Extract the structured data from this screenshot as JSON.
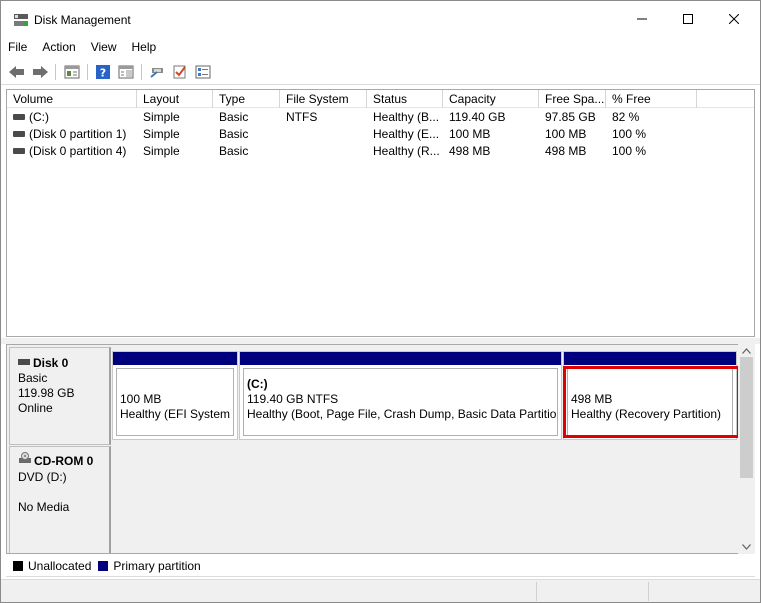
{
  "window": {
    "title": "Disk Management"
  },
  "menu": [
    "File",
    "Action",
    "View",
    "Help"
  ],
  "volume_list": {
    "columns": [
      "Volume",
      "Layout",
      "Type",
      "File System",
      "Status",
      "Capacity",
      "Free Spa...",
      "% Free"
    ],
    "rows": [
      {
        "volume": "(C:)",
        "layout": "Simple",
        "type": "Basic",
        "fs": "NTFS",
        "status": "Healthy (B...",
        "capacity": "119.40 GB",
        "free": "97.85 GB",
        "pct": "82 %"
      },
      {
        "volume": "(Disk 0 partition 1)",
        "layout": "Simple",
        "type": "Basic",
        "fs": "",
        "status": "Healthy (E...",
        "capacity": "100 MB",
        "free": "100 MB",
        "pct": "100 %"
      },
      {
        "volume": "(Disk 0 partition 4)",
        "layout": "Simple",
        "type": "Basic",
        "fs": "",
        "status": "Healthy (R...",
        "capacity": "498 MB",
        "free": "498 MB",
        "pct": "100 %"
      }
    ]
  },
  "disk0": {
    "name": "Disk 0",
    "type": "Basic",
    "size": "119.98 GB",
    "state": "Online",
    "partitions": [
      {
        "name": "",
        "size": "100 MB",
        "status": "Healthy (EFI System P"
      },
      {
        "name": "(C:)",
        "size": "119.40 GB NTFS",
        "status": "Healthy (Boot, Page File, Crash Dump, Basic Data Partition)"
      },
      {
        "name": "",
        "size": "498 MB",
        "status": "Healthy (Recovery Partition)"
      }
    ]
  },
  "cdrom0": {
    "name": "CD-ROM 0",
    "type": "DVD (D:)",
    "media": "No Media"
  },
  "legend": [
    {
      "label": "Unallocated",
      "color": "#000000"
    },
    {
      "label": "Primary partition",
      "color": "#00007f"
    }
  ],
  "colors": {
    "partition_bar": "#00007f",
    "selection": "#e00000"
  }
}
